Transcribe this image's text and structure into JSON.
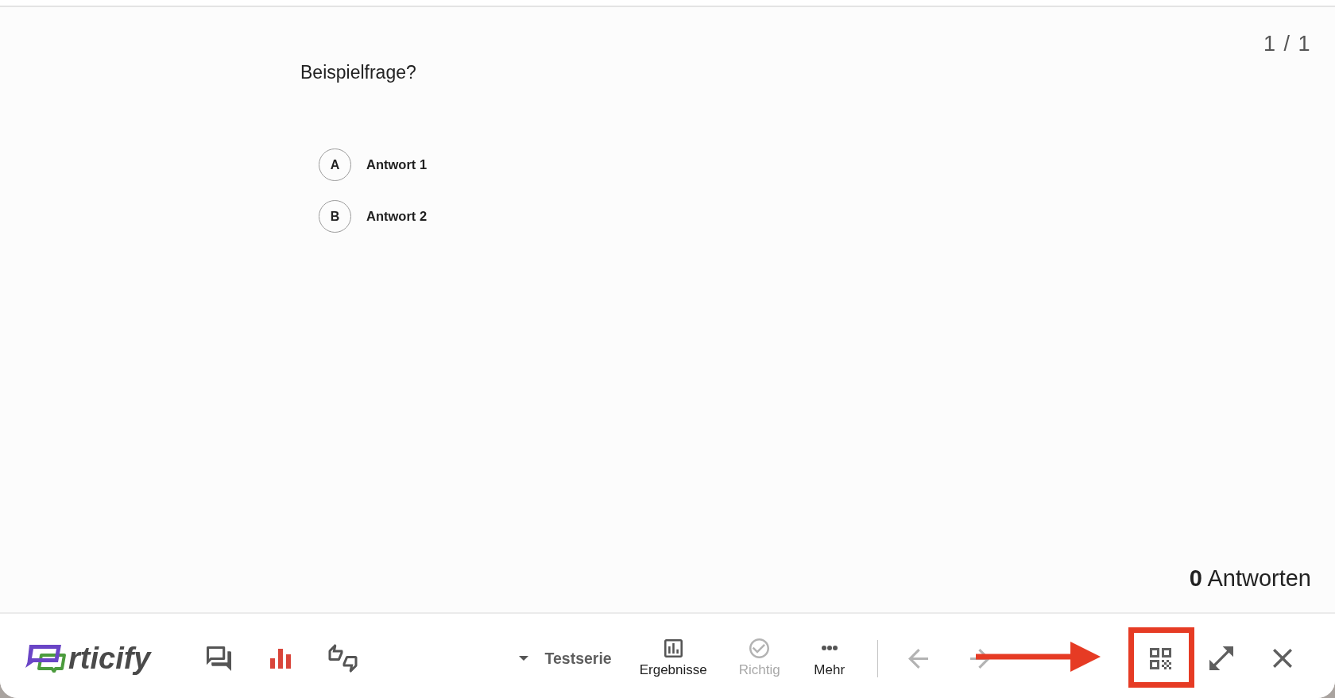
{
  "slide_counter": "1 / 1",
  "question": "Beispielfrage?",
  "answers": [
    {
      "letter": "A",
      "text": "Antwort 1"
    },
    {
      "letter": "B",
      "text": "Antwort 2"
    }
  ],
  "responses": "**0** Antworten",
  "toolbar": {
    "logo_wordmark": "rticify",
    "modes": [
      {
        "kind": "comments",
        "selected": false
      },
      {
        "kind": "chart",
        "selected": true
      },
      {
        "kind": "feedback",
        "selected": false
      }
    ],
    "series": "Testserie",
    "actions": [
      {
        "kind": "results",
        "label": "Ergebnisse",
        "disabled": false
      },
      {
        "kind": "correct",
        "label": "Richtig",
        "disabled": true
      },
      {
        "kind": "more",
        "label": "Mehr",
        "disabled": false
      }
    ],
    "navigation": [
      {
        "kind": "previous",
        "disabled": true
      },
      {
        "kind": "next",
        "disabled": true
      }
    ]
  }
}
